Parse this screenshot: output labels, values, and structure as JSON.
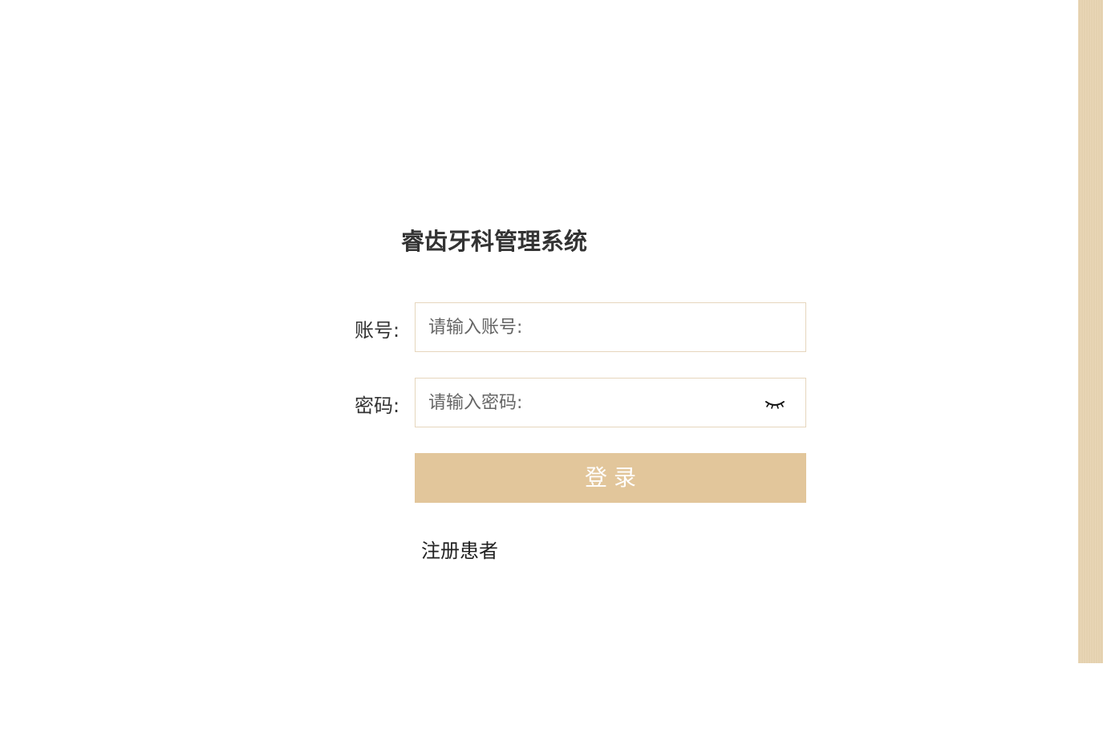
{
  "app": {
    "title": "睿齿牙科管理系统"
  },
  "form": {
    "account": {
      "label": "账号:",
      "placeholder": "请输入账号:",
      "value": ""
    },
    "password": {
      "label": "密码:",
      "placeholder": "请输入密码:",
      "value": "",
      "toggle_icon": "eye-closed-icon"
    },
    "login_label": "登录",
    "register_label": "注册患者"
  },
  "colors": {
    "accent": "#e2c69b",
    "side_strip": "#e8d4b2",
    "input_border": "#e6d6bd",
    "text": "#333333"
  }
}
